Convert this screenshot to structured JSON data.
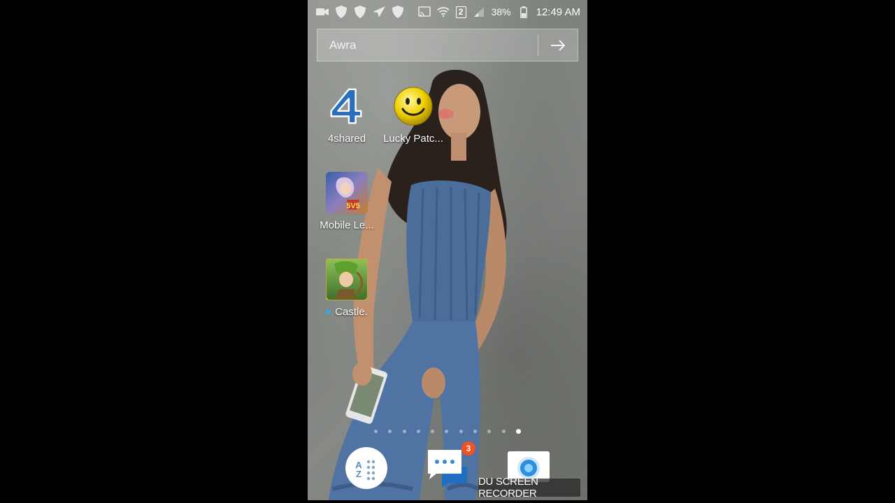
{
  "status_bar": {
    "battery_percent": "38%",
    "time": "12:49 AM",
    "sim_slot": "2",
    "icons": [
      "video-camera-icon",
      "shield-icon",
      "shield-icon",
      "send-icon",
      "shield-icon",
      "cast-icon",
      "wifi-icon",
      "sim-2-icon",
      "signal-icon"
    ]
  },
  "search": {
    "value": "Awra",
    "go_icon": "arrow-right-icon"
  },
  "apps": [
    {
      "label": "4shared",
      "icon": "4shared-icon"
    },
    {
      "label": "Lucky Patc...",
      "icon": "lucky-patcher-icon"
    },
    {
      "label": "Mobile Le...",
      "icon": "mobile-legends-icon"
    },
    {
      "label": "Castle.",
      "icon": "castle-clash-icon",
      "new": true
    }
  ],
  "page_indicator": {
    "count": 11,
    "active_index": 10
  },
  "dock": [
    {
      "icon": "app-drawer-icon",
      "label_glyphs": "A Z"
    },
    {
      "icon": "messages-icon",
      "badge": "3"
    },
    {
      "icon": "camera-icon"
    }
  ],
  "watermark": "DU SCREEN RECORDER",
  "colors": {
    "badge": "#f4511e",
    "new_dot": "#3aa6e6",
    "four_shared_blue": "#2a6ebd"
  }
}
